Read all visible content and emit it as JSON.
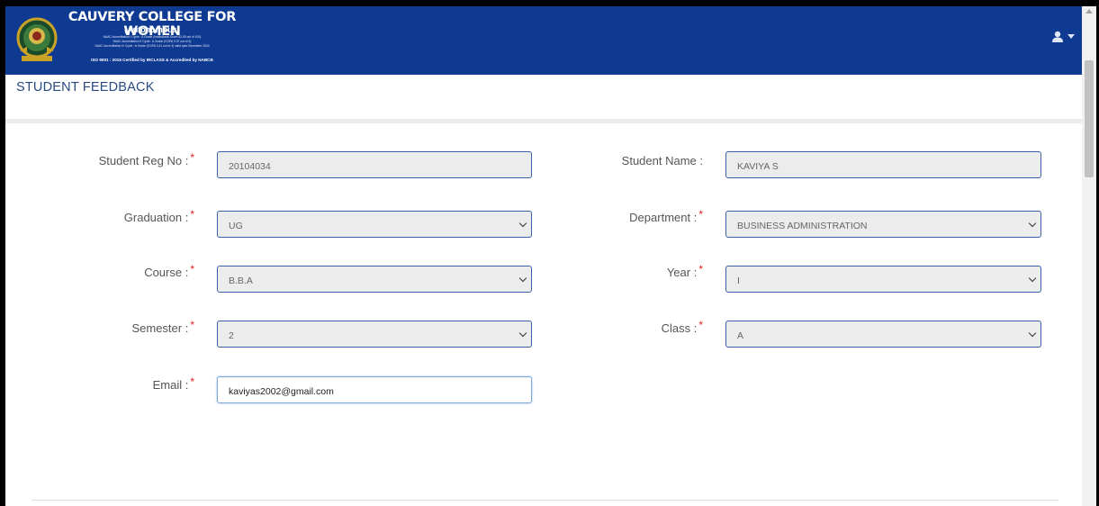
{
  "header": {
    "college_name": "CAUVERY COLLEGE FOR WOMEN",
    "subtitle": "(Autonomous)",
    "accreditation_lines": [
      "NAAC Accreditation I Cycle : A Grade (Institutional Score 82.05 out of 100)",
      "NAAC Accreditation II Cycle : A Grade (CGPA 3.37 out of 4)",
      "NAAC Accreditation III Cycle : A Grade (CGPA 3.41 out of 4) valid upto December 2024"
    ],
    "iso_line": "ISO 9001 : 2015 Certified by IRCLASS & Accredited by NABCB",
    "colors": {
      "bar": "#0e3a92",
      "title_text": "#2a4a82",
      "required_star": "#e02020"
    },
    "user_icon": "user-icon"
  },
  "page": {
    "title": "STUDENT FEEDBACK"
  },
  "form": {
    "reg_no": {
      "label": "Student Reg No :",
      "value": "20104034",
      "required": "*"
    },
    "student_name": {
      "label": "Student Name :",
      "value": "KAVIYA S"
    },
    "graduation": {
      "label": "Graduation :",
      "value": "UG",
      "required": "*"
    },
    "department": {
      "label": "Department :",
      "value": "BUSINESS ADMINISTRATION",
      "required": "*"
    },
    "course": {
      "label": "Course :",
      "value": "B.B.A",
      "required": "*"
    },
    "year": {
      "label": "Year :",
      "value": "I",
      "required": "*"
    },
    "semester": {
      "label": "Semester :",
      "value": "2",
      "required": "*"
    },
    "class": {
      "label": "Class :",
      "value": "A",
      "required": "*"
    },
    "email": {
      "label": "Email :",
      "value": "kaviyas2002@gmail.com",
      "required": "*"
    }
  }
}
